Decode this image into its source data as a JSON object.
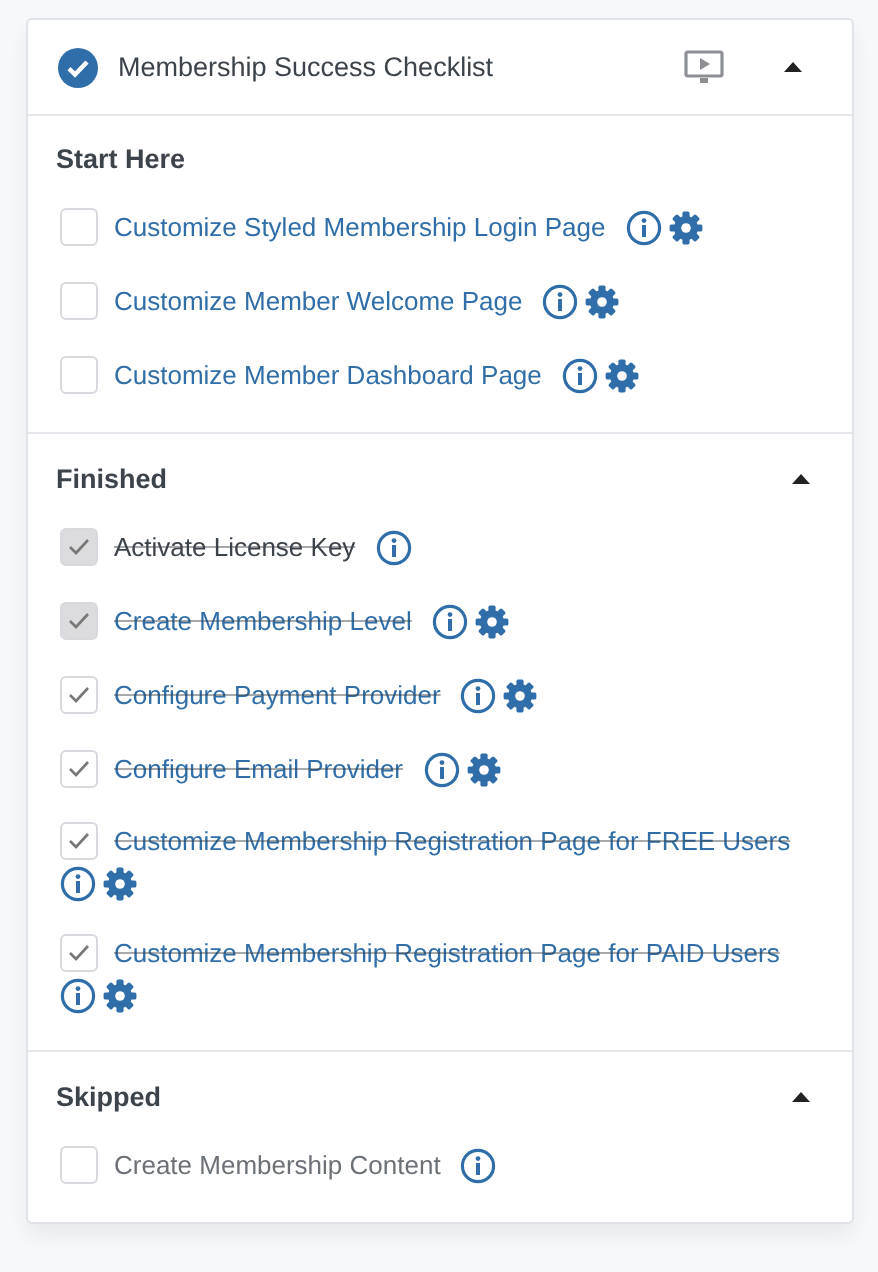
{
  "checklist": {
    "title": "Membership Success Checklist",
    "completed": true,
    "expanded": true
  },
  "sections": [
    {
      "title": "Start Here",
      "collapsible": false,
      "expanded": true,
      "items": [
        {
          "label": "Customize Styled Membership Login Page",
          "kind": "link",
          "checked": false,
          "disabled": false,
          "settings": true
        },
        {
          "label": "Customize Member Welcome Page",
          "kind": "link",
          "checked": false,
          "disabled": false,
          "settings": true
        },
        {
          "label": "Customize Member Dashboard Page",
          "kind": "link",
          "checked": false,
          "disabled": false,
          "settings": true
        }
      ]
    },
    {
      "title": "Finished",
      "collapsible": true,
      "expanded": true,
      "items": [
        {
          "label": "Activate License Key",
          "kind": "plain",
          "checked": true,
          "disabled": true,
          "settings": false
        },
        {
          "label": "Create Membership Level",
          "kind": "link",
          "checked": true,
          "disabled": true,
          "settings": true
        },
        {
          "label": "Configure Payment Provider",
          "kind": "link",
          "checked": true,
          "disabled": false,
          "settings": true
        },
        {
          "label": "Configure Email Provider",
          "kind": "link",
          "checked": true,
          "disabled": false,
          "settings": true
        },
        {
          "label": "Customize Membership Registration Page for FREE Users",
          "kind": "link",
          "checked": true,
          "disabled": false,
          "settings": true
        },
        {
          "label": "Customize Membership Registration Page for PAID Users",
          "kind": "link",
          "checked": true,
          "disabled": false,
          "settings": true
        }
      ]
    },
    {
      "title": "Skipped",
      "collapsible": true,
      "expanded": true,
      "items": [
        {
          "label": "Create Membership Content",
          "kind": "muted",
          "checked": false,
          "disabled": false,
          "settings": false
        }
      ]
    }
  ]
}
